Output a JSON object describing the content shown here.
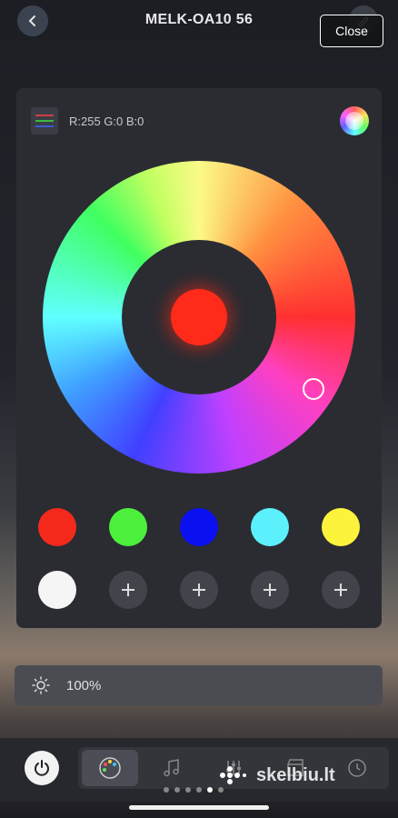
{
  "header": {
    "title": "MELK-OA10   56",
    "close_label": "Close"
  },
  "color_panel": {
    "rgb_readout": "R:255 G:0 B:0",
    "selected_color": "#ff2a1a",
    "presets": [
      "#f4291c",
      "#4cf03c",
      "#0b10f0",
      "#5cf0fc",
      "#fcf43c",
      "#f5f5f5"
    ],
    "add_slots": 4
  },
  "brightness": {
    "value": "100%"
  },
  "bottom_nav": {
    "tabs": [
      "palette-icon",
      "music-note-icon",
      "equalizer-icon",
      "clapperboard-icon",
      "timer-icon"
    ],
    "active_tab": 0
  },
  "page_indicator": {
    "count": 6,
    "active": 5
  },
  "watermark": {
    "text": "skelbiu.lt"
  }
}
